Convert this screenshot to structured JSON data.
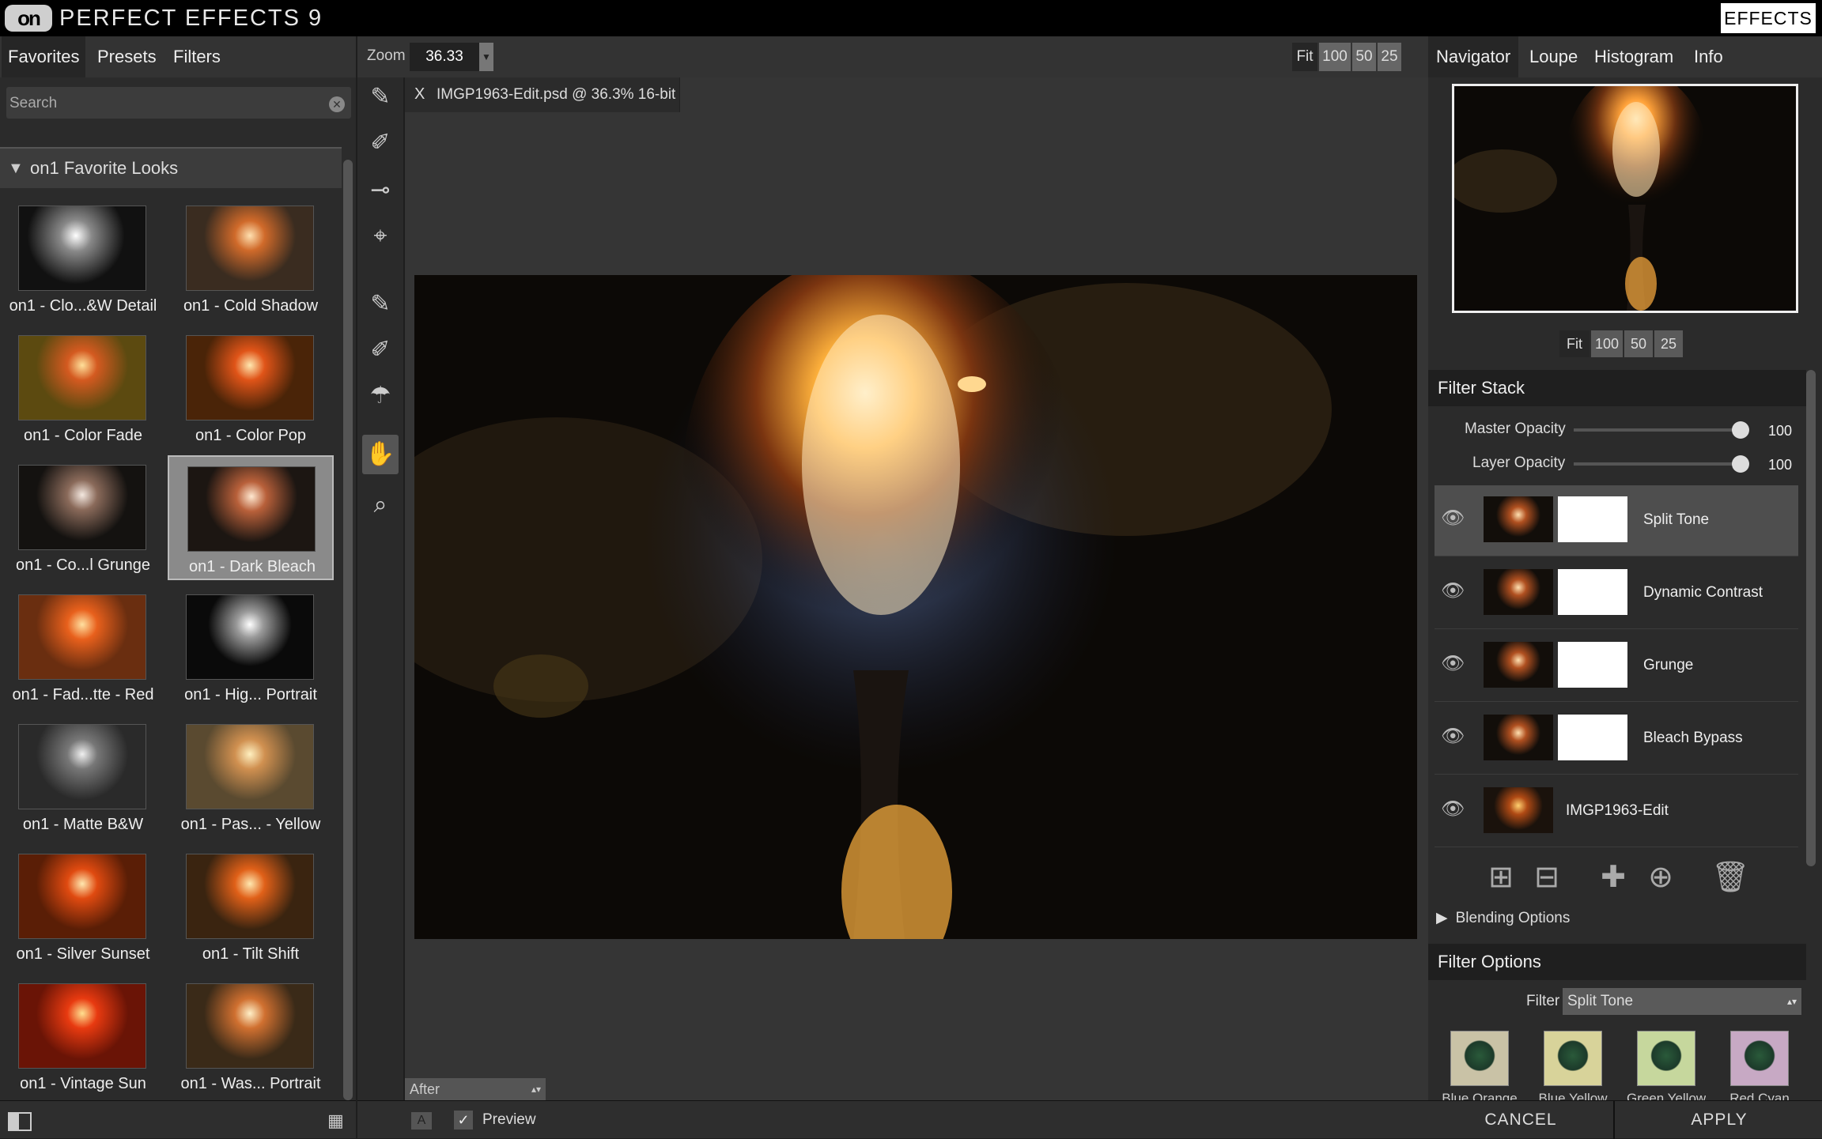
{
  "app": {
    "title": "PERFECT EFFECTS 9",
    "logo_text": "on",
    "effects_button": "EFFECTS"
  },
  "left": {
    "tabs": [
      "Favorites",
      "Presets",
      "Filters"
    ],
    "search_placeholder": "Search",
    "group_title": "on1 Favorite Looks",
    "presets": [
      {
        "label": "on1 - Clo...&W Detail",
        "style": "bw",
        "selected": false
      },
      {
        "label": "on1 - Cold Shadow",
        "style": "cold",
        "selected": false
      },
      {
        "label": "on1 - Color Fade",
        "style": "fade",
        "selected": false
      },
      {
        "label": "on1 - Color Pop",
        "style": "pop",
        "selected": false
      },
      {
        "label": "on1 - Co...l Grunge",
        "style": "grunge",
        "selected": false
      },
      {
        "label": "on1 - Dark Bleach",
        "style": "dark",
        "selected": true
      },
      {
        "label": "on1 - Fad...tte - Red",
        "style": "red",
        "selected": false
      },
      {
        "label": "on1 - Hig... Portrait",
        "style": "bw2",
        "selected": false
      },
      {
        "label": "on1 - Matte B&W",
        "style": "matte",
        "selected": false
      },
      {
        "label": "on1 - Pas... - Yellow",
        "style": "pastel",
        "selected": false
      },
      {
        "label": "on1 - Silver Sunset",
        "style": "sunset",
        "selected": false
      },
      {
        "label": "on1 - Tilt Shift",
        "style": "tilt",
        "selected": false
      },
      {
        "label": "on1 - Vintage Sun",
        "style": "vintage",
        "selected": false
      },
      {
        "label": "on1 - Was... Portrait",
        "style": "washed",
        "selected": false
      }
    ]
  },
  "center": {
    "zoom_label": "Zoom",
    "zoom_value": "36.33",
    "zoom_buttons": [
      "Fit",
      "100",
      "50",
      "25"
    ],
    "doc_tab": "IMGP1963-Edit.psd @ 36.3% 16-bit",
    "doc_close": "X",
    "view_mode": "After",
    "compare_label": "A",
    "preview_check": "✓",
    "preview_label": "Preview"
  },
  "right": {
    "tabs": [
      "Navigator",
      "Loupe",
      "Histogram",
      "Info"
    ],
    "nav_zoom_buttons": [
      "Fit",
      "100",
      "50",
      "25"
    ],
    "filter_stack_title": "Filter Stack",
    "master_opacity_label": "Master Opacity",
    "master_opacity": "100",
    "layer_opacity_label": "Layer Opacity",
    "layer_opacity": "100",
    "layers": [
      {
        "name": "Split Tone",
        "selected": true
      },
      {
        "name": "Dynamic Contrast",
        "selected": false
      },
      {
        "name": "Grunge",
        "selected": false
      },
      {
        "name": "Bleach Bypass",
        "selected": false
      }
    ],
    "base_layer": "IMGP1963-Edit",
    "blending_options": "Blending Options",
    "filter_options_title": "Filter Options",
    "filter_label": "Filter",
    "filter_value": "Split Tone",
    "swatches": [
      {
        "label": "Blue Orange",
        "tint": "#c9c2a6"
      },
      {
        "label": "Blue Yellow",
        "tint": "#d8d39a"
      },
      {
        "label": "Green Yellow",
        "tint": "#c6d79d"
      },
      {
        "label": "Red Cyan",
        "tint": "#c7a9c4"
      }
    ],
    "cancel": "CANCEL",
    "apply": "APPLY"
  }
}
